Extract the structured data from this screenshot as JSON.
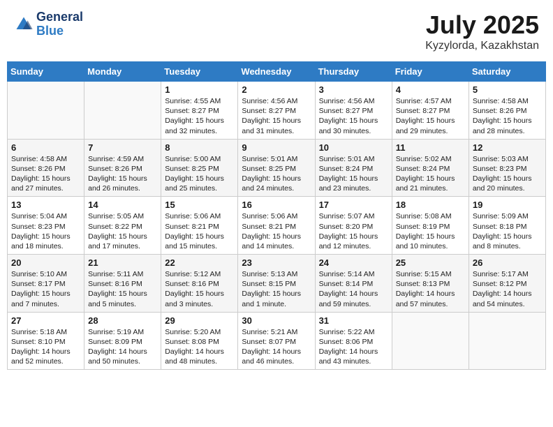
{
  "header": {
    "logo_line1": "General",
    "logo_line2": "Blue",
    "month": "July 2025",
    "location": "Kyzylorda, Kazakhstan"
  },
  "days_of_week": [
    "Sunday",
    "Monday",
    "Tuesday",
    "Wednesday",
    "Thursday",
    "Friday",
    "Saturday"
  ],
  "weeks": [
    [
      {
        "day": "",
        "content": ""
      },
      {
        "day": "",
        "content": ""
      },
      {
        "day": "1",
        "content": "Sunrise: 4:55 AM\nSunset: 8:27 PM\nDaylight: 15 hours\nand 32 minutes."
      },
      {
        "day": "2",
        "content": "Sunrise: 4:56 AM\nSunset: 8:27 PM\nDaylight: 15 hours\nand 31 minutes."
      },
      {
        "day": "3",
        "content": "Sunrise: 4:56 AM\nSunset: 8:27 PM\nDaylight: 15 hours\nand 30 minutes."
      },
      {
        "day": "4",
        "content": "Sunrise: 4:57 AM\nSunset: 8:27 PM\nDaylight: 15 hours\nand 29 minutes."
      },
      {
        "day": "5",
        "content": "Sunrise: 4:58 AM\nSunset: 8:26 PM\nDaylight: 15 hours\nand 28 minutes."
      }
    ],
    [
      {
        "day": "6",
        "content": "Sunrise: 4:58 AM\nSunset: 8:26 PM\nDaylight: 15 hours\nand 27 minutes."
      },
      {
        "day": "7",
        "content": "Sunrise: 4:59 AM\nSunset: 8:26 PM\nDaylight: 15 hours\nand 26 minutes."
      },
      {
        "day": "8",
        "content": "Sunrise: 5:00 AM\nSunset: 8:25 PM\nDaylight: 15 hours\nand 25 minutes."
      },
      {
        "day": "9",
        "content": "Sunrise: 5:01 AM\nSunset: 8:25 PM\nDaylight: 15 hours\nand 24 minutes."
      },
      {
        "day": "10",
        "content": "Sunrise: 5:01 AM\nSunset: 8:24 PM\nDaylight: 15 hours\nand 23 minutes."
      },
      {
        "day": "11",
        "content": "Sunrise: 5:02 AM\nSunset: 8:24 PM\nDaylight: 15 hours\nand 21 minutes."
      },
      {
        "day": "12",
        "content": "Sunrise: 5:03 AM\nSunset: 8:23 PM\nDaylight: 15 hours\nand 20 minutes."
      }
    ],
    [
      {
        "day": "13",
        "content": "Sunrise: 5:04 AM\nSunset: 8:23 PM\nDaylight: 15 hours\nand 18 minutes."
      },
      {
        "day": "14",
        "content": "Sunrise: 5:05 AM\nSunset: 8:22 PM\nDaylight: 15 hours\nand 17 minutes."
      },
      {
        "day": "15",
        "content": "Sunrise: 5:06 AM\nSunset: 8:21 PM\nDaylight: 15 hours\nand 15 minutes."
      },
      {
        "day": "16",
        "content": "Sunrise: 5:06 AM\nSunset: 8:21 PM\nDaylight: 15 hours\nand 14 minutes."
      },
      {
        "day": "17",
        "content": "Sunrise: 5:07 AM\nSunset: 8:20 PM\nDaylight: 15 hours\nand 12 minutes."
      },
      {
        "day": "18",
        "content": "Sunrise: 5:08 AM\nSunset: 8:19 PM\nDaylight: 15 hours\nand 10 minutes."
      },
      {
        "day": "19",
        "content": "Sunrise: 5:09 AM\nSunset: 8:18 PM\nDaylight: 15 hours\nand 8 minutes."
      }
    ],
    [
      {
        "day": "20",
        "content": "Sunrise: 5:10 AM\nSunset: 8:17 PM\nDaylight: 15 hours\nand 7 minutes."
      },
      {
        "day": "21",
        "content": "Sunrise: 5:11 AM\nSunset: 8:16 PM\nDaylight: 15 hours\nand 5 minutes."
      },
      {
        "day": "22",
        "content": "Sunrise: 5:12 AM\nSunset: 8:16 PM\nDaylight: 15 hours\nand 3 minutes."
      },
      {
        "day": "23",
        "content": "Sunrise: 5:13 AM\nSunset: 8:15 PM\nDaylight: 15 hours\nand 1 minute."
      },
      {
        "day": "24",
        "content": "Sunrise: 5:14 AM\nSunset: 8:14 PM\nDaylight: 14 hours\nand 59 minutes."
      },
      {
        "day": "25",
        "content": "Sunrise: 5:15 AM\nSunset: 8:13 PM\nDaylight: 14 hours\nand 57 minutes."
      },
      {
        "day": "26",
        "content": "Sunrise: 5:17 AM\nSunset: 8:12 PM\nDaylight: 14 hours\nand 54 minutes."
      }
    ],
    [
      {
        "day": "27",
        "content": "Sunrise: 5:18 AM\nSunset: 8:10 PM\nDaylight: 14 hours\nand 52 minutes."
      },
      {
        "day": "28",
        "content": "Sunrise: 5:19 AM\nSunset: 8:09 PM\nDaylight: 14 hours\nand 50 minutes."
      },
      {
        "day": "29",
        "content": "Sunrise: 5:20 AM\nSunset: 8:08 PM\nDaylight: 14 hours\nand 48 minutes."
      },
      {
        "day": "30",
        "content": "Sunrise: 5:21 AM\nSunset: 8:07 PM\nDaylight: 14 hours\nand 46 minutes."
      },
      {
        "day": "31",
        "content": "Sunrise: 5:22 AM\nSunset: 8:06 PM\nDaylight: 14 hours\nand 43 minutes."
      },
      {
        "day": "",
        "content": ""
      },
      {
        "day": "",
        "content": ""
      }
    ]
  ]
}
